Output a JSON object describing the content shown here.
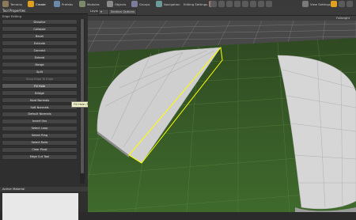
{
  "toolbar": {
    "items": [
      {
        "label": "Terrains",
        "icon": "terrain-icon",
        "color": "#8a7a5a"
      },
      {
        "label": "Create",
        "icon": "create-icon",
        "color": "#e0a020",
        "active": true
      },
      {
        "label": "Prefabs",
        "icon": "prefab-icon",
        "color": "#6a8aa8"
      },
      {
        "label": "Modules",
        "icon": "module-icon",
        "color": "#7a8a6a"
      },
      {
        "label": "Objects",
        "icon": "object-icon",
        "color": "#8a8a8a"
      },
      {
        "label": "Groups",
        "icon": "group-icon",
        "color": "#7c7c9c"
      },
      {
        "label": "Navigation",
        "icon": "navigation-icon",
        "color": "#6a9a9a"
      },
      {
        "label": "Editing Settings",
        "icon": "editing-settings-icon",
        "color": "#9a7a7a"
      },
      {
        "label": "View Settings",
        "icon": "view-settings-icon",
        "color": "#7a7a7a"
      }
    ]
  },
  "left_panel": {
    "title": "Tool Properties",
    "section": "Edge Editing",
    "tools": [
      {
        "label": "Dissolve",
        "state": "normal"
      },
      {
        "label": "Collapse",
        "state": "normal"
      },
      {
        "label": "Bevel",
        "state": "normal"
      },
      {
        "label": "Extrude",
        "state": "normal"
      },
      {
        "label": "Connect",
        "state": "normal"
      },
      {
        "label": "Extend",
        "state": "normal"
      },
      {
        "label": "Merge",
        "state": "normal"
      },
      {
        "label": "Split",
        "state": "normal"
      },
      {
        "label": "Snap Edge To Edge",
        "state": "disabled"
      },
      {
        "label": "Fill Hole",
        "state": "selected"
      },
      {
        "label": "Bridge",
        "state": "normal"
      },
      {
        "label": "Hard Normals",
        "state": "normal"
      },
      {
        "label": "Soft Normals",
        "state": "normal"
      },
      {
        "label": "Default Normals",
        "state": "normal"
      },
      {
        "label": "Invert Uvs",
        "state": "normal"
      },
      {
        "label": "Select Loop",
        "state": "normal"
      },
      {
        "label": "Select Ring",
        "state": "normal"
      },
      {
        "label": "Select Rails",
        "state": "normal"
      },
      {
        "label": "Clear Pivot",
        "state": "normal"
      },
      {
        "label": "Edge Cut Tool",
        "state": "normal"
      }
    ],
    "tooltip": "Fill Hole (F)",
    "material_title": "Active Material"
  },
  "viewport": {
    "layout_label": "Layout",
    "section_options_label": "Section Options",
    "view_label": "Fullbright"
  },
  "colors": {
    "grass": "#3d5f2a",
    "wireframe": "#c8c8c8",
    "selection": "#ffff00",
    "mesh": "#d2d2d2"
  }
}
